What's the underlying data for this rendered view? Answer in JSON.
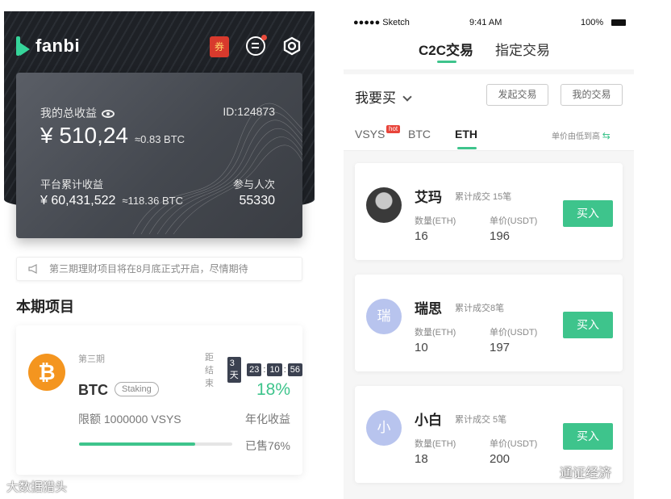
{
  "left_app": {
    "brand": "fanbi",
    "coupon_label": "券",
    "card": {
      "total_label": "我的总收益",
      "id_text": "ID:124873",
      "total_value": "¥ 510,24",
      "total_btc": "≈0.83 BTC",
      "platform_label": "平台累计收益",
      "platform_value": "¥ 60,431,522",
      "platform_btc": "≈118.36 BTC",
      "participants_label": "参与人次",
      "participants_value": "55330"
    },
    "notice": "第三期理财项目将在8月底正式开启，尽情期待",
    "section_title": "本期项目",
    "project": {
      "period": "第三期",
      "countdown_label": "距结束",
      "countdown": {
        "days": "3天",
        "hours": "23",
        "minutes": "10",
        "seconds": "56"
      },
      "coin": "BTC",
      "coin_symbol": "₿",
      "tag": "Staking",
      "rate": "18%",
      "limit": "限额 1000000 VSYS",
      "rate_label": "年化收益",
      "sold_label": "已售76%",
      "sold_fraction": 0.76
    },
    "watermark": "大数据猎头"
  },
  "right_app": {
    "status_bar": {
      "carrier": "●●●●● Sketch",
      "time": "9:41 AM",
      "battery": "100%"
    },
    "tabs": [
      "C2C交易",
      "指定交易"
    ],
    "want_label": "我要买",
    "buttons": {
      "initiate": "发起交易",
      "mine": "我的交易"
    },
    "coin_tabs": [
      "VSYS",
      "BTC",
      "ETH"
    ],
    "hot_badge": "hot",
    "sort_label": "单价由低到高",
    "sort_icon": "⇆",
    "offers": [
      {
        "name": "艾玛",
        "count": "累计成交 15笔",
        "qty_label": "数量(ETH)",
        "price_label": "单价(USDT)",
        "qty": "16",
        "price": "196",
        "buy": "买入",
        "avatar_text": "",
        "avatar": "photo"
      },
      {
        "name": "瑞思",
        "count": "累计成交8笔",
        "qty_label": "数量(ETH)",
        "price_label": "单价(USDT)",
        "qty": "10",
        "price": "197",
        "buy": "买入",
        "avatar_text": "瑞",
        "avatar": "soft"
      },
      {
        "name": "小白",
        "count": "累计成交 5笔",
        "qty_label": "数量(ETH)",
        "price_label": "单价(USDT)",
        "qty": "18",
        "price": "200",
        "buy": "买入",
        "avatar_text": "小",
        "avatar": "soft"
      }
    ],
    "watermark": "通证经济"
  },
  "colors": {
    "accent": "#3ec48c",
    "dark_header": "#1e2126",
    "coin_orange": "#f4951f",
    "hot_red": "#e8443a"
  }
}
